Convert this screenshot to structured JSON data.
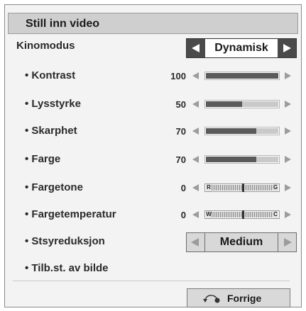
{
  "title": "Still inn video",
  "mode": {
    "label": "Kinomodus",
    "value": "Dynamisk"
  },
  "sliders": [
    {
      "label": "• Kontrast",
      "value": "100",
      "level": 100
    },
    {
      "label": "• Lysstyrke",
      "value": "50",
      "level": 50
    },
    {
      "label": "• Skarphet",
      "value": "70",
      "level": 70
    },
    {
      "label": "• Farge",
      "value": "70",
      "level": 70
    }
  ],
  "balances": [
    {
      "label": "• Fargetone",
      "value": "0",
      "left_end": "R",
      "right_end": "G",
      "level": 0
    },
    {
      "label": "• Fargetemperatur",
      "value": "0",
      "left_end": "W",
      "right_end": "C",
      "level": 0
    }
  ],
  "noise": {
    "label": "• Stsyreduksjon",
    "value": "Medium"
  },
  "reset": {
    "label": "• Tilb.st. av bilde"
  },
  "back": {
    "label": "Forrige"
  }
}
